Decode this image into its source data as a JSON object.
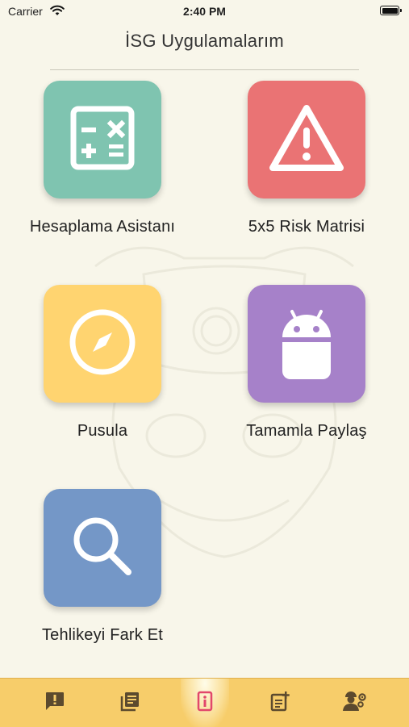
{
  "status_bar": {
    "carrier": "Carrier",
    "time": "2:40 PM"
  },
  "page_title": "İSG Uygulamalarım",
  "colors": {
    "background": "#f8f6ea",
    "teal": "#7fc4b0",
    "red": "#ea7374",
    "yellow": "#ffd470",
    "purple": "#a681c9",
    "blue": "#7497c7",
    "tabbar": "#f7cd6a",
    "tab_icon": "#5c4a2e",
    "tab_active": "#e2476b"
  },
  "apps": [
    {
      "label": "Hesaplama Asistanı",
      "icon": "calculator-icon"
    },
    {
      "label": "5x5 Risk Matrisi",
      "icon": "warning-icon"
    },
    {
      "label": "Pusula",
      "icon": "compass-icon"
    },
    {
      "label": "Tamamla Paylaş",
      "icon": "android-icon"
    },
    {
      "label": "Tehlikeyi Fark Et",
      "icon": "search-icon"
    }
  ],
  "tabs": [
    {
      "icon": "alert-message-icon",
      "active": false
    },
    {
      "icon": "library-icon",
      "active": false
    },
    {
      "icon": "info-icon",
      "active": true
    },
    {
      "icon": "add-note-icon",
      "active": false
    },
    {
      "icon": "worker-settings-icon",
      "active": false
    }
  ]
}
